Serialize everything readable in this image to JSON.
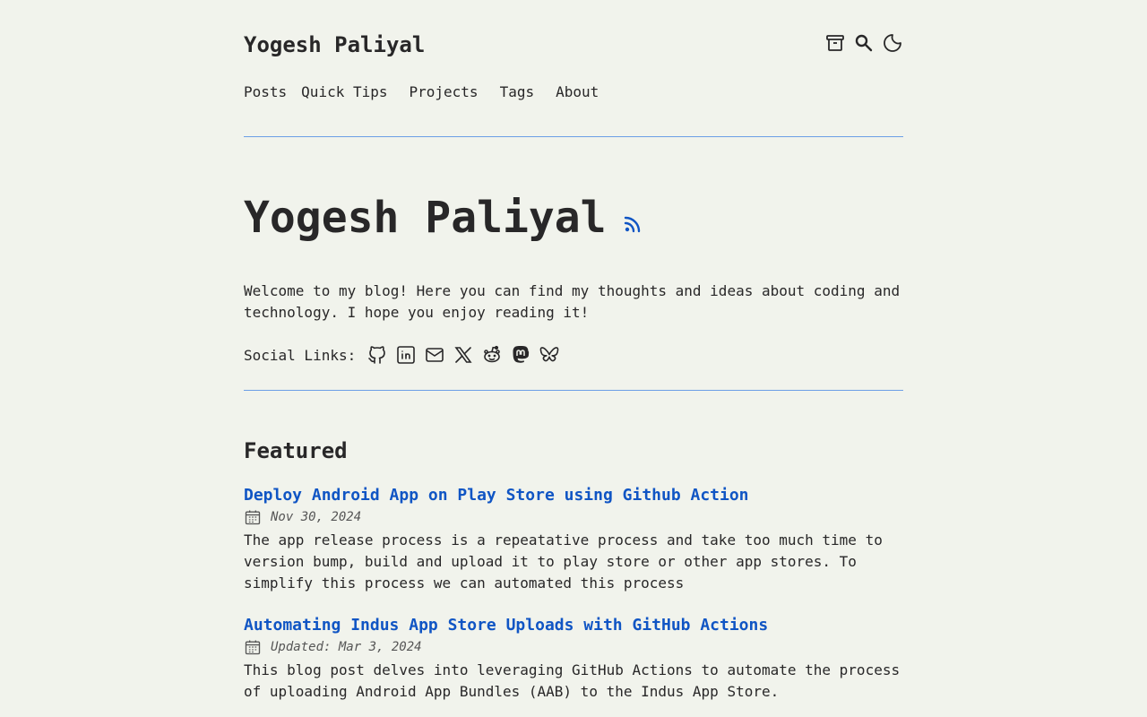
{
  "site": {
    "title": "Yogesh Paliyal"
  },
  "nav": {
    "items": [
      {
        "label": "Posts"
      },
      {
        "label": "Quick Tips"
      },
      {
        "label": "Projects"
      },
      {
        "label": "Tags"
      },
      {
        "label": "About"
      }
    ]
  },
  "header_icons": [
    "archive-icon",
    "search-icon",
    "theme-toggle-icon"
  ],
  "hero": {
    "title": "Yogesh Paliyal",
    "intro": "Welcome to my blog! Here you can find my thoughts and ideas about coding and technology. I hope you enjoy reading it!",
    "social_label": "Social Links:",
    "social_icons": [
      "github-icon",
      "linkedin-icon",
      "mail-icon",
      "x-icon",
      "reddit-icon",
      "mastodon-icon",
      "bluesky-icon"
    ]
  },
  "featured": {
    "heading": "Featured",
    "posts": [
      {
        "title": "Deploy Android App on Play Store using Github Action",
        "date": "Nov 30, 2024",
        "description": "The app release process is a repeatative process and take too much time to version bump, build and upload it to play store or other app stores. To simplify this process we can automated this process"
      },
      {
        "title": "Automating Indus App Store Uploads with GitHub Actions",
        "date": "Updated: Mar 3, 2024",
        "description": "This blog post delves into leveraging GitHub Actions to automate the process of uploading Android App Bundles (AAB) to the Indus App Store."
      }
    ]
  },
  "colors": {
    "background": "#f1f3ec",
    "text": "#282728",
    "accent": "#1055c4",
    "rule": "#6c9fe6"
  }
}
